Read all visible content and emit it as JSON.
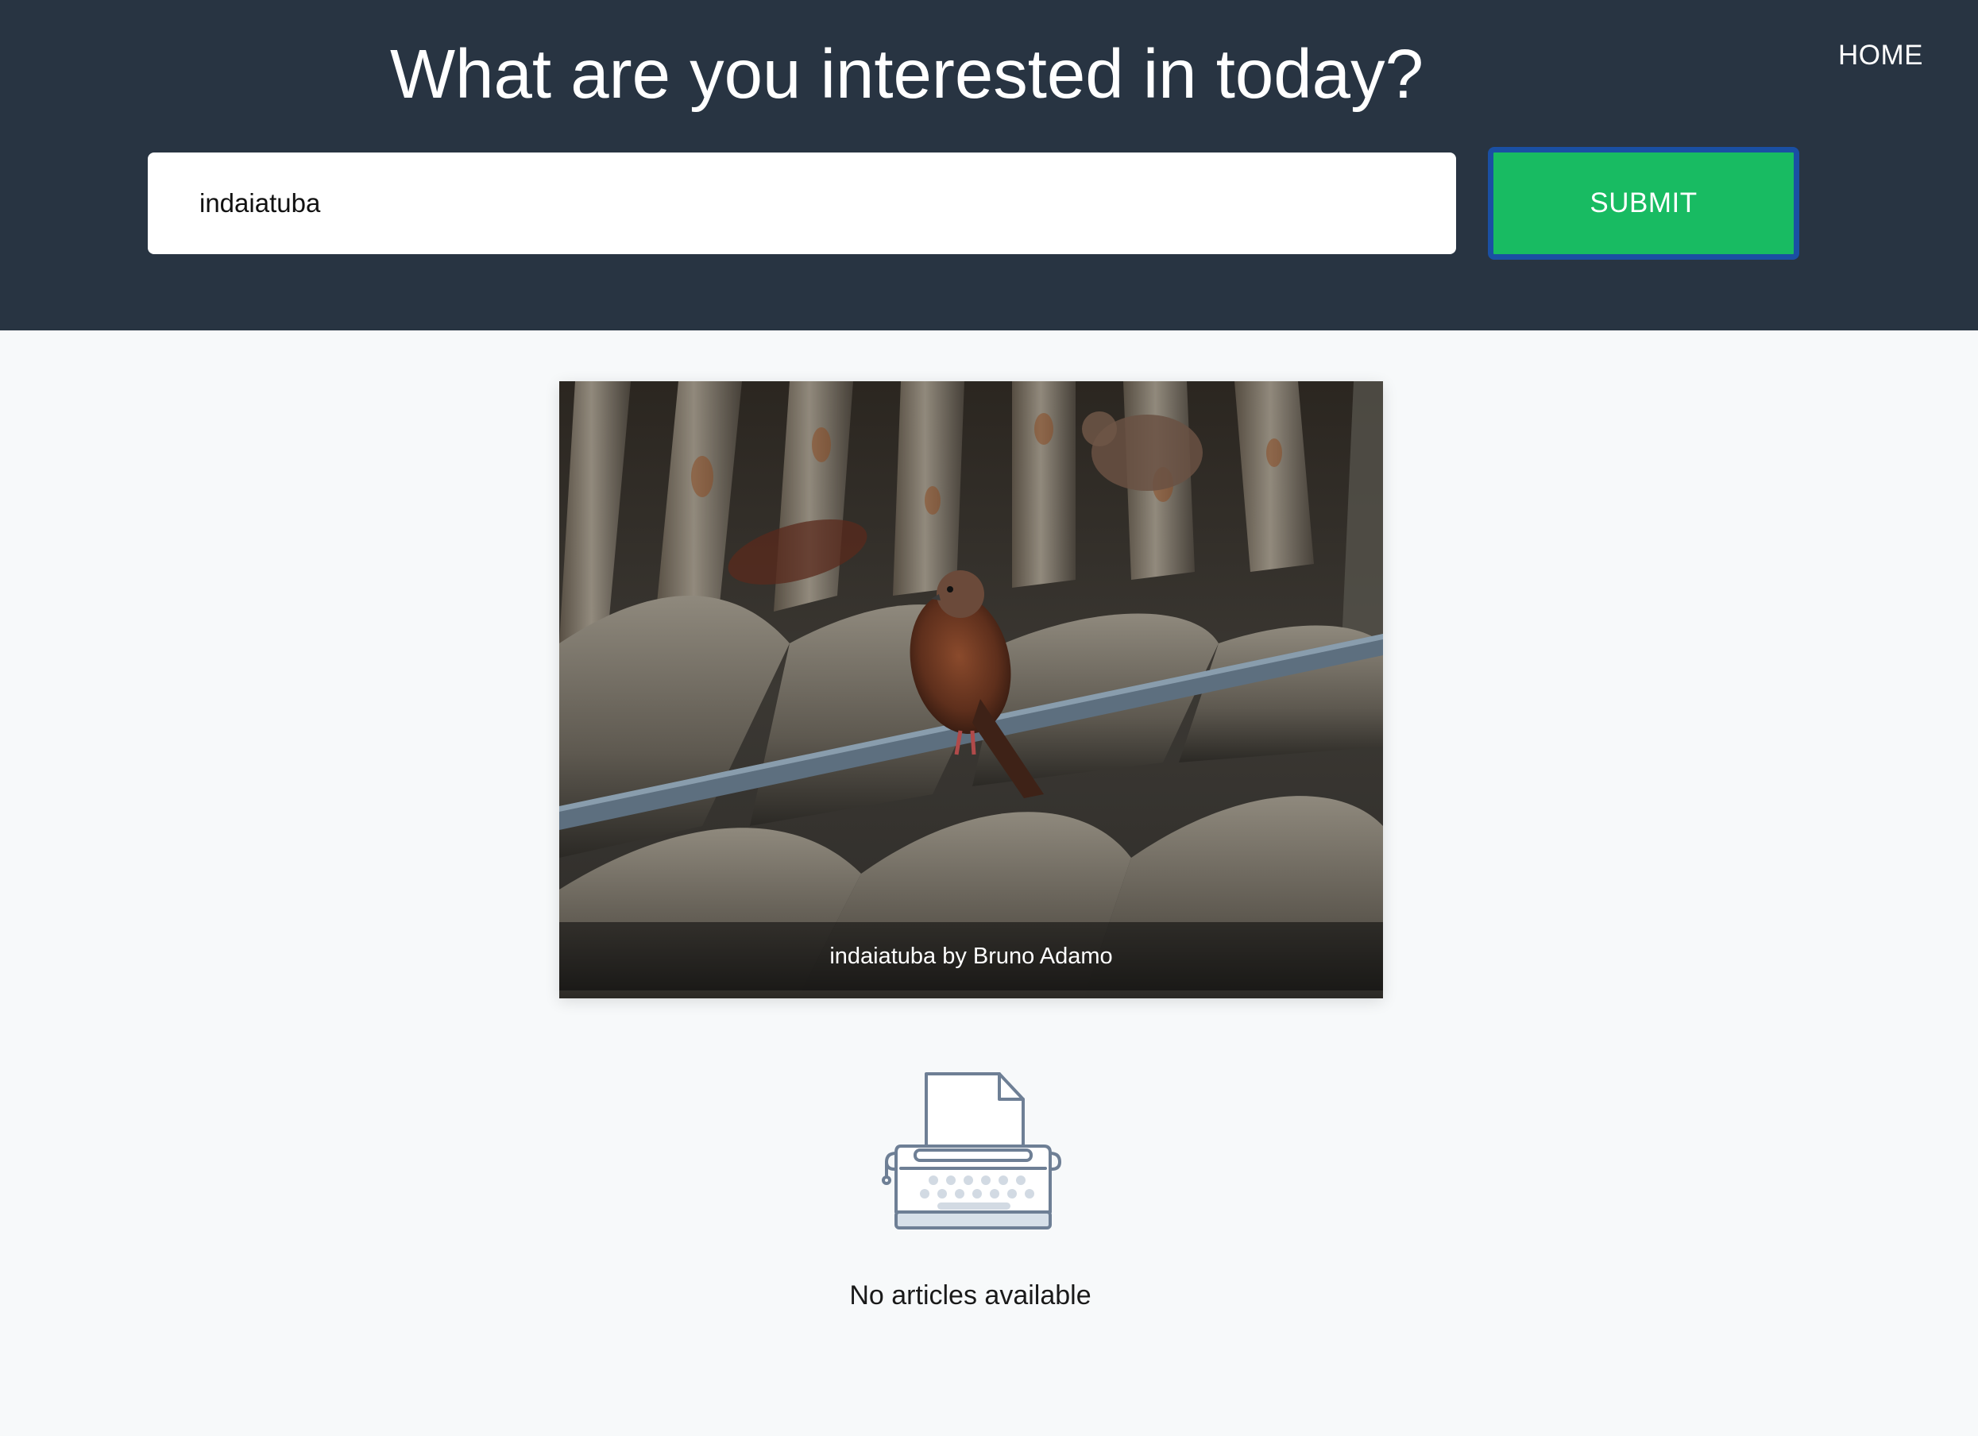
{
  "nav": {
    "home_label": "HOME"
  },
  "header": {
    "headline": "What are you interested in today?"
  },
  "search": {
    "value": "indaiatuba",
    "placeholder": "",
    "submit_label": "SUBMIT"
  },
  "photo": {
    "caption": "indaiatuba by Bruno Adamo",
    "icon": "photo-of-bird-on-roof"
  },
  "articles": {
    "empty_icon": "typewriter-icon",
    "empty_message": "No articles available"
  },
  "colors": {
    "header_bg": "#283442",
    "page_bg": "#f7f9fa",
    "submit_bg": "#18bb62",
    "submit_border": "#1a4fa3",
    "icon_stroke": "#6e7f95"
  }
}
